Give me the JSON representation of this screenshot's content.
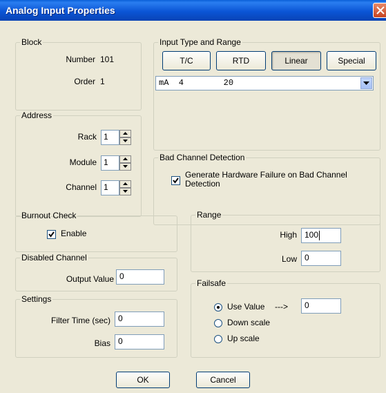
{
  "window": {
    "title": "Analog Input Properties"
  },
  "block": {
    "legend": "Block",
    "number_label": "Number",
    "number_value": "101",
    "order_label": "Order",
    "order_value": "1"
  },
  "input_type": {
    "legend": "Input Type and Range",
    "buttons": [
      {
        "label": "T/C",
        "selected": false
      },
      {
        "label": "RTD",
        "selected": false
      },
      {
        "label": "Linear",
        "selected": true
      },
      {
        "label": "Special",
        "selected": false
      }
    ],
    "range_select": "mA  4        20"
  },
  "address": {
    "legend": "Address",
    "rack_label": "Rack",
    "rack_value": "1",
    "module_label": "Module",
    "module_value": "1",
    "channel_label": "Channel",
    "channel_value": "1"
  },
  "bad_channel": {
    "legend": "Bad Channel Detection",
    "checkbox_label": "Generate Hardware Failure on Bad Channel Detection",
    "checked": true
  },
  "burnout": {
    "legend": "Burnout Check",
    "enable_label": "Enable",
    "checked": true
  },
  "range": {
    "legend": "Range",
    "high_label": "High",
    "high_value": "100",
    "low_label": "Low",
    "low_value": "0"
  },
  "disabled_channel": {
    "legend": "Disabled Channel",
    "output_label": "Output Value",
    "output_value": "0"
  },
  "failsafe": {
    "legend": "Failsafe",
    "options": [
      {
        "label": "Use Value",
        "selected": true
      },
      {
        "label": "Down scale",
        "selected": false
      },
      {
        "label": "Up scale",
        "selected": false
      }
    ],
    "arrow": "--->",
    "value": "0"
  },
  "settings": {
    "legend": "Settings",
    "filter_label": "Filter Time (sec)",
    "filter_value": "0",
    "bias_label": "Bias",
    "bias_value": "0"
  },
  "footer": {
    "ok_label": "OK",
    "cancel_label": "Cancel"
  },
  "colors": {
    "titlebar": "#0a55d6",
    "dialog_bg": "#ece9d8",
    "close_button": "#d2572e"
  }
}
